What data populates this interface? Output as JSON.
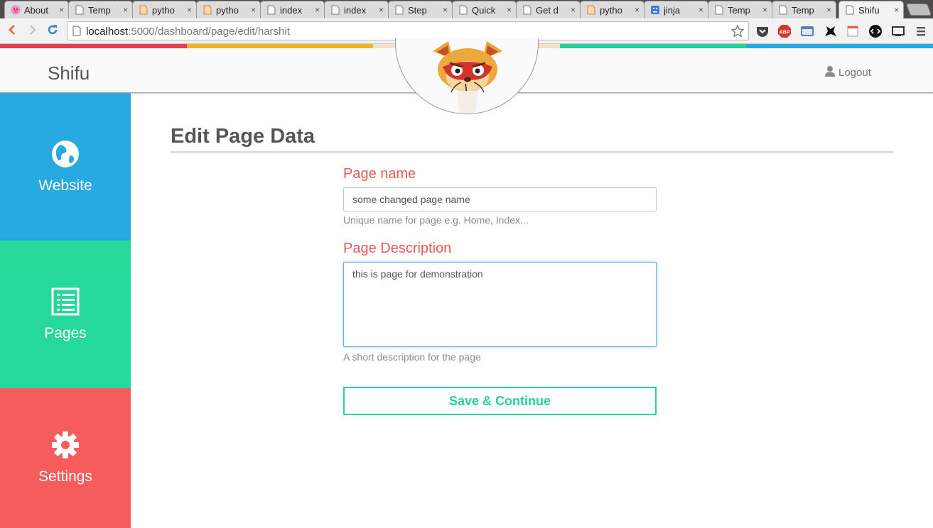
{
  "browser": {
    "tabs": [
      {
        "title": "About",
        "icon": "pig-icon"
      },
      {
        "title": "Temp",
        "icon": "doc-icon"
      },
      {
        "title": "pytho",
        "icon": "python-icon"
      },
      {
        "title": "pytho",
        "icon": "python-icon"
      },
      {
        "title": "index",
        "icon": "doc-icon"
      },
      {
        "title": "index",
        "icon": "doc-icon"
      },
      {
        "title": "Step",
        "icon": "doc-icon"
      },
      {
        "title": "Quick",
        "icon": "doc-icon"
      },
      {
        "title": "Get d",
        "icon": "doc-icon"
      },
      {
        "title": "pytho",
        "icon": "python-icon"
      },
      {
        "title": "jinja",
        "icon": "bot-icon"
      },
      {
        "title": "Temp",
        "icon": "doc-icon"
      },
      {
        "title": "Temp",
        "icon": "doc-icon"
      },
      {
        "title": "Shifu",
        "icon": "doc-icon"
      }
    ],
    "close_glyph": "×",
    "url_host": "localhost",
    "url_rest": ":5000/dashboard/page/edit/harshit"
  },
  "colors": {
    "red": "#e2404f",
    "yellow": "#f0b429",
    "cream": "#f3e2c4",
    "teal": "#25d19d",
    "blue": "#29a9e1",
    "sidebar_website": "#29a9e1",
    "sidebar_pages": "#25d99a",
    "sidebar_settings": "#f65c5c"
  },
  "header": {
    "brand": "Shifu",
    "logout": "Logout"
  },
  "sidebar": {
    "items": [
      {
        "label": "Website",
        "icon": "globe-icon"
      },
      {
        "label": "Pages",
        "icon": "list-icon"
      },
      {
        "label": "Settings",
        "icon": "gear-icon"
      }
    ]
  },
  "main": {
    "title": "Edit Page Data",
    "page_name_label": "Page name",
    "page_name_value": "some changed page name",
    "page_name_help": "Unique name for page e.g. Home, Index...",
    "page_desc_label": "Page Description",
    "page_desc_value": "this is page for demonstration",
    "page_desc_help": "A short description for the page",
    "save_label": "Save & Continue"
  }
}
